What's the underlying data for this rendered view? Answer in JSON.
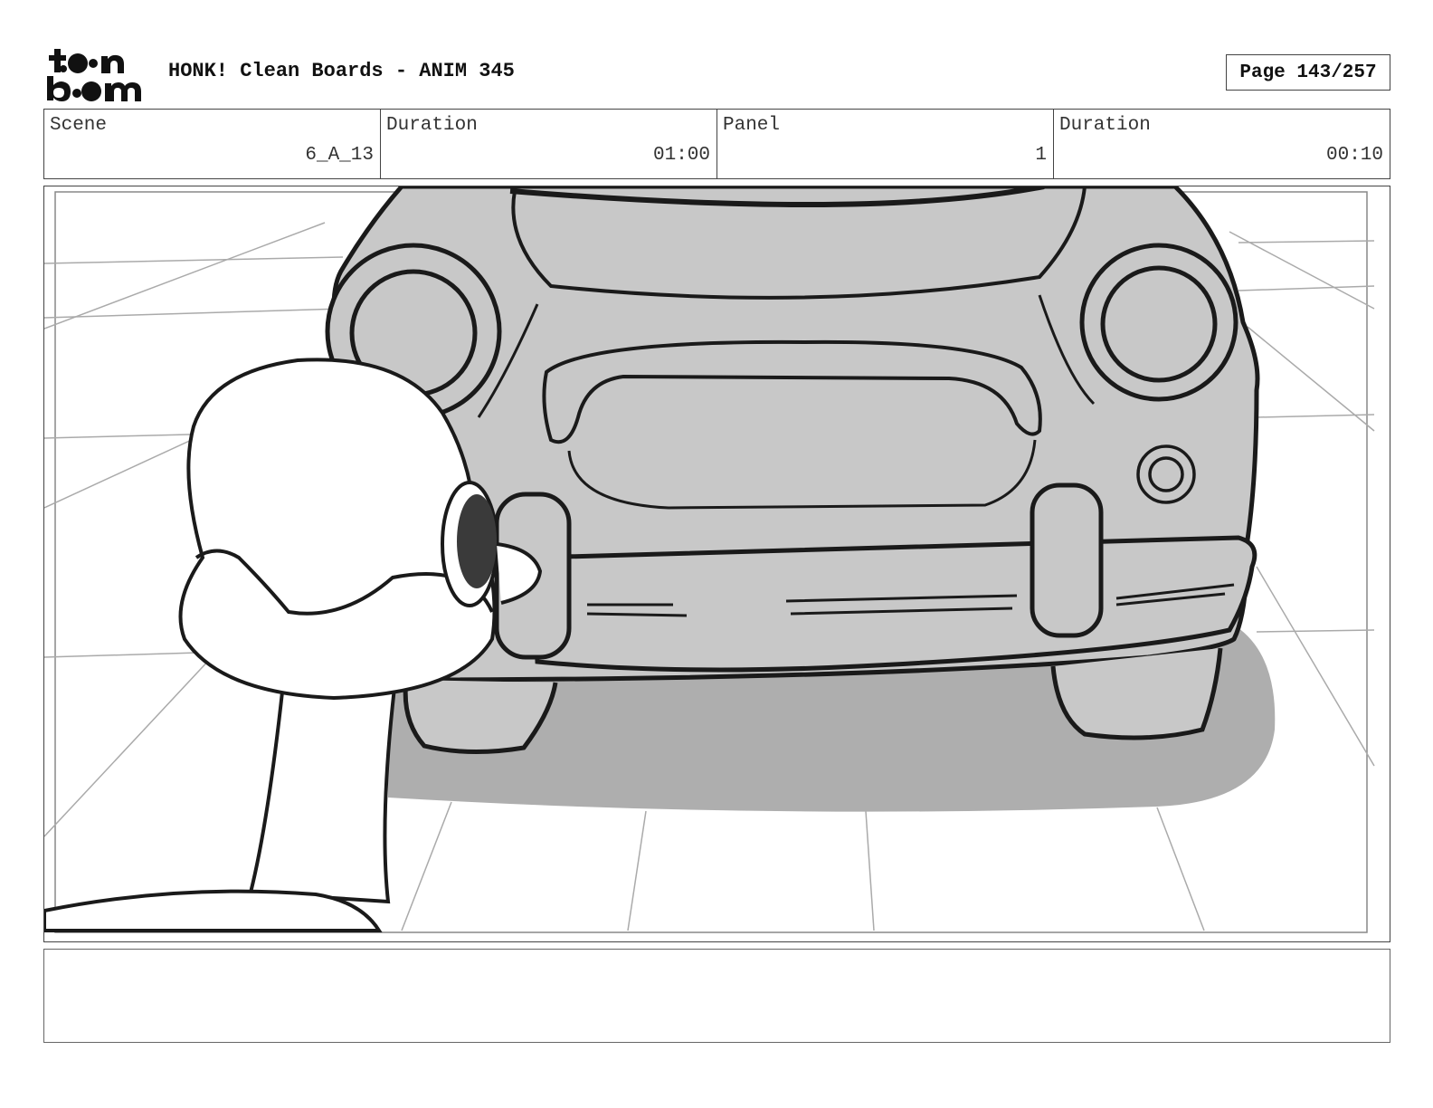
{
  "header": {
    "logo_text": "toon boom",
    "title": "HONK! Clean Boards - ANIM 345",
    "page": "Page 143/257"
  },
  "info": {
    "scene_label": "Scene",
    "scene_value": "6_A_13",
    "scene_duration_label": "Duration",
    "scene_duration_value": "01:00",
    "panel_label": "Panel",
    "panel_value": "1",
    "panel_duration_label": "Duration",
    "panel_duration_value": "00:10"
  },
  "panel": {
    "image_description_icon": "storyboard-drawing"
  },
  "notes": {
    "text": ""
  }
}
